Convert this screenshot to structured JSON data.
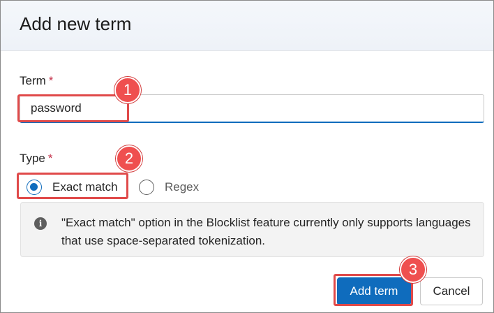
{
  "dialog": {
    "title": "Add new term"
  },
  "term": {
    "label": "Term",
    "required_mark": "*",
    "value": "password"
  },
  "type": {
    "label": "Type",
    "required_mark": "*",
    "options": [
      {
        "label": "Exact match",
        "selected": true
      },
      {
        "label": "Regex",
        "selected": false
      }
    ]
  },
  "info": {
    "icon": "info-icon",
    "icon_glyph": "i",
    "text": "\"Exact match\" option in the Blocklist feature currently only supports languages that use space-separated tokenization."
  },
  "buttons": {
    "add_label": "Add term",
    "cancel_label": "Cancel"
  },
  "callouts": [
    "1",
    "2",
    "3"
  ],
  "colors": {
    "accent": "#0f6cbd",
    "callout": "#e04a4a",
    "required": "#c4314b"
  }
}
